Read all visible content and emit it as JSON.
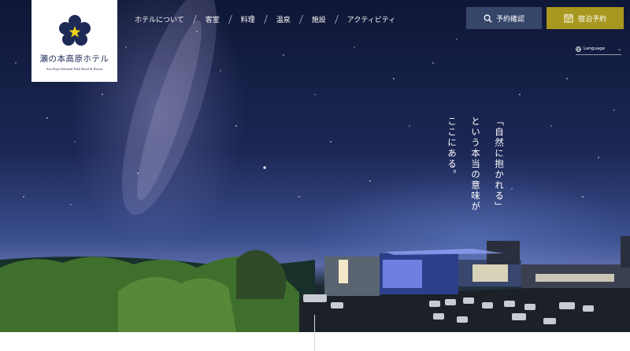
{
  "logo": {
    "title": "瀬の本高原ホテル",
    "subtitle": "Aso Kuju National Park Hotel & Resort"
  },
  "nav": {
    "items": [
      {
        "label": "ホテルについて"
      },
      {
        "label": "客室"
      },
      {
        "label": "料理"
      },
      {
        "label": "温泉"
      },
      {
        "label": "施設"
      },
      {
        "label": "アクティビティ"
      }
    ]
  },
  "buttons": {
    "confirm_label": "予約確認",
    "reserve_label": "宿泊予約"
  },
  "language": {
    "label": "Language"
  },
  "hero": {
    "copy_lines": [
      "「自然に抱かれる」",
      "という本当の意味が",
      "ここにある。"
    ]
  },
  "colors": {
    "navy": "#1c2a55",
    "confirm_bg": "#36466b",
    "reserve_bg": "#a9981f",
    "logo_star": "#f2d21b"
  },
  "icons": [
    "star-logo-icon",
    "search-icon",
    "calendar-icon",
    "globe-icon",
    "chevron-down-icon"
  ]
}
